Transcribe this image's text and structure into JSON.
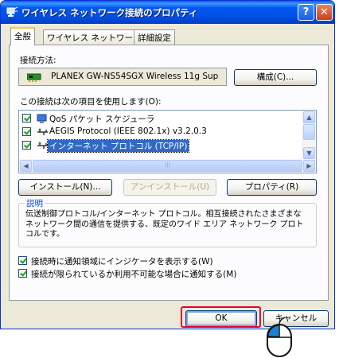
{
  "window": {
    "title": "ワイヤレス ネットワーク接続のプロパティ",
    "help_label": "?",
    "close_label": "✕"
  },
  "tabs": [
    {
      "label": "全般",
      "active": true
    },
    {
      "label": "ワイヤレス ネットワーク",
      "active": false
    },
    {
      "label": "詳細設定",
      "active": false
    }
  ],
  "connection": {
    "method_label": "接続方法:",
    "adapter_name": "PLANEX GW-NS54SGX Wireless 11g Sup",
    "configure_button": "構成(C)..."
  },
  "items_label": "この接続は次の項目を使用します(O):",
  "items": [
    {
      "label": "QoS パケット スケジューラ",
      "checked": true,
      "icon": "scheduler-icon",
      "selected": false
    },
    {
      "label": "AEGIS Protocol (IEEE 802.1x) v3.2.0.3",
      "checked": true,
      "icon": "protocol-icon",
      "selected": false
    },
    {
      "label": "インターネット プロトコル (TCP/IP)",
      "checked": true,
      "icon": "protocol-icon",
      "selected": true
    }
  ],
  "actions": {
    "install": "インストール(N)...",
    "uninstall": "アンインストール(U)",
    "properties": "プロパティ(R)"
  },
  "description": {
    "title": "説明",
    "text": "伝送制御プロトコル/インターネット プロトコル。相互接続されたさまざまなネットワーク間の通信を提供する、既定のワイド エリア ネットワーク プロトコルです。"
  },
  "options": [
    {
      "label": "接続時に通知領域にインジケータを表示する(W)",
      "checked": true
    },
    {
      "label": "接続が限られているか利用不可能な場合に通知する(M)",
      "checked": true
    }
  ],
  "footer": {
    "ok": "OK",
    "cancel": "キャンセル"
  },
  "colors": {
    "titlebar": "#0058ee",
    "highlight_box": "#e60039",
    "selection": "#316ac5"
  }
}
